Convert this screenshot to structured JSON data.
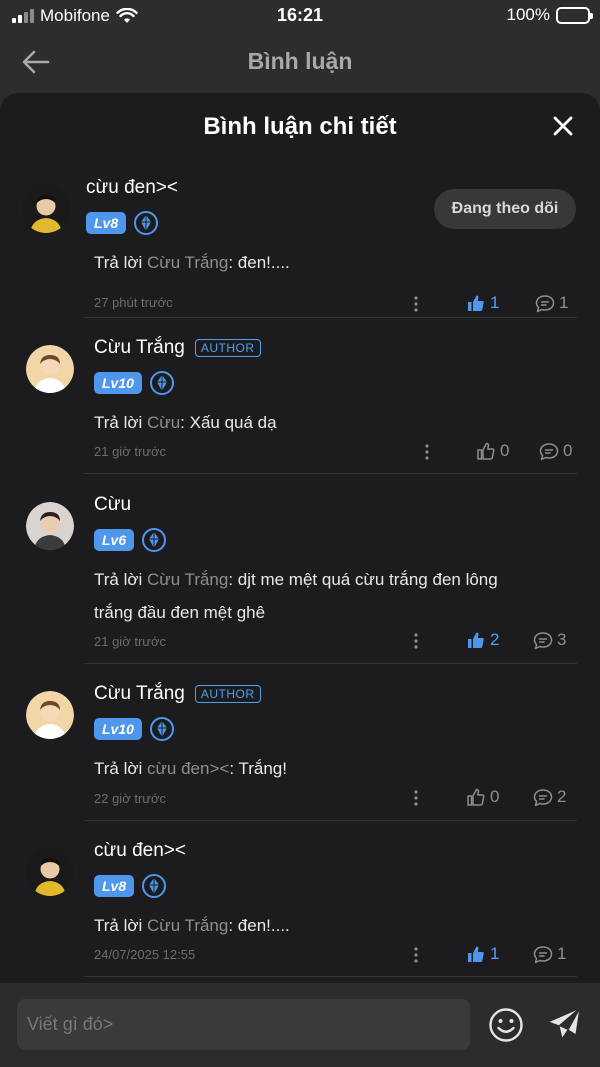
{
  "status_bar": {
    "carrier": "Mobifone",
    "time": "16:21",
    "battery": "100%"
  },
  "page_header": {
    "title": "Bình luận"
  },
  "sheet": {
    "title": "Bình luận chi tiết",
    "follow_label": "Đang theo dõi"
  },
  "comments": [
    {
      "name": "cừu đen><",
      "level": "Lv8",
      "author": false,
      "reply_prefix": "Trả lời ",
      "mention": "Cừu Trắng",
      "body_lines": [
        ": đen!...."
      ],
      "time": "27 phút trước",
      "likes": "1",
      "liked": true,
      "replies": "1"
    },
    {
      "name": "Cừu Trắng",
      "level": "Lv10",
      "author": true,
      "author_label": "AUTHOR",
      "reply_prefix": "Trả lời ",
      "mention": "Cừu",
      "body_lines": [
        ": Xấu quá dạ"
      ],
      "time": "21 giờ trước",
      "likes": "0",
      "liked": false,
      "replies": "0"
    },
    {
      "name": "Cừu",
      "level": "Lv6",
      "author": false,
      "reply_prefix": "Trả lời ",
      "mention": "Cừu Trắng",
      "body_lines": [
        ": djt me mệt quá cừu trắng đen lông",
        "trắng đầu đen mệt ghê"
      ],
      "time": "21 giờ trước",
      "likes": "2",
      "liked": true,
      "replies": "3"
    },
    {
      "name": "Cừu Trắng",
      "level": "Lv10",
      "author": true,
      "author_label": "AUTHOR",
      "reply_prefix": "Trả lời ",
      "mention": "cừu đen><",
      "body_lines": [
        ": Trắng!"
      ],
      "time": "22 giờ trước",
      "likes": "0",
      "liked": false,
      "replies": "2"
    },
    {
      "name": "cừu đen><",
      "level": "Lv8",
      "author": false,
      "reply_prefix": "Trả lời ",
      "mention": "Cừu Trắng",
      "body_lines": [
        ": đen!...."
      ],
      "time": "24/07/2025 12:55",
      "likes": "1",
      "liked": true,
      "replies": "1"
    }
  ],
  "input": {
    "placeholder": "Viết gì đó>"
  },
  "colors": {
    "accent": "#4e97ec",
    "sheet_bg": "#1c1c1e",
    "page_bg": "#2c2c2e"
  },
  "icons": [
    "back-arrow-icon",
    "close-icon",
    "gem-icon",
    "more-icon",
    "thumb-up-icon",
    "comment-bubble-icon",
    "emoji-icon",
    "send-icon",
    "signal-icon",
    "wifi-icon",
    "battery-icon"
  ]
}
